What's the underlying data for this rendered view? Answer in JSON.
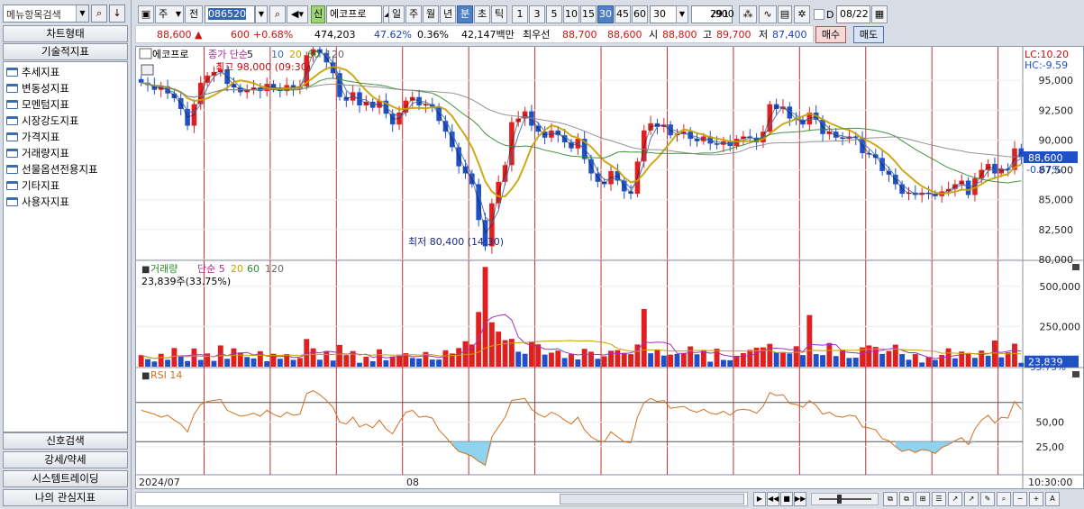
{
  "left_panel": {
    "search_placeholder": "메뉴항목검색",
    "search_btn": "Q",
    "down_btn": "↓",
    "tab_chart_type": "차트형태",
    "tab_tech": "기술적지표",
    "tree": [
      "추세지표",
      "변동성지표",
      "모멘텀지표",
      "시장강도지표",
      "가격지표",
      "거래량지표",
      "선물옵션전용지표",
      "기타지표",
      "사용자지표"
    ],
    "bottom_tabs": [
      "신호검색",
      "강세/약세",
      "시스템트레이딩",
      "나의 관심지표"
    ]
  },
  "toolbar": {
    "period_main": "주",
    "period_prev": "전",
    "code": "086520",
    "new_badge": "신",
    "stock_name": "에코프로",
    "period_buttons": [
      "일",
      "주",
      "월",
      "년",
      "분",
      "초",
      "틱"
    ],
    "active_period": "분",
    "intervals": [
      "1",
      "3",
      "5",
      "10",
      "15",
      "30",
      "45",
      "60"
    ],
    "active_interval": "30",
    "interval_select": "30",
    "count_value": "291",
    "count_total": "/900",
    "date_value": "08/22",
    "check_label": "D"
  },
  "quote": {
    "price": "88,600",
    "arrow": "▲",
    "change": "600",
    "change_pct": "+0.68%",
    "volume": "474,203",
    "ratio1": "47.62%",
    "ratio2": "0.36%",
    "amount": "42,147백만",
    "bid_label": "최우선",
    "bid1": "88,700",
    "bid2": "88,600",
    "open_label": "시",
    "open": "88,800",
    "high_label": "고",
    "high": "89,700",
    "low_label": "저",
    "low": "87,400",
    "buy_label": "매수",
    "sell_label": "매도"
  },
  "chart_data": [
    {
      "type": "candlestick",
      "title": "에코프로",
      "indicator": "종가 단순 5 10 20 60 120",
      "ma_periods": [
        "5",
        "10",
        "20",
        "60",
        "120"
      ],
      "ma_colors": [
        "#1a1a1a",
        "#3a6db5",
        "#c9a000",
        "#2e8b2e",
        "#888888"
      ],
      "ylim": [
        80000,
        97500
      ],
      "yticks": [
        "95,000",
        "92,500",
        "90,000",
        "87,500",
        "85,000",
        "82,500",
        "80,000"
      ],
      "last_price_label": "88,600",
      "last_pct_label": "-0.67%",
      "lc_label": "LC:10.20",
      "hc_label": "HC:-9.59",
      "max_label": "최고 98,000 (09:30)",
      "min_label": "최저 80,400 (14:30)",
      "close": [
        94800,
        94600,
        94200,
        94500,
        93900,
        93500,
        92600,
        91200,
        93000,
        94800,
        95400,
        95700,
        95900,
        94700,
        94400,
        94000,
        94200,
        94400,
        94100,
        94700,
        94300,
        94100,
        94600,
        94300,
        94500,
        97100,
        97600,
        97300,
        96500,
        95600,
        93600,
        93300,
        94000,
        92900,
        93200,
        92700,
        93300,
        92200,
        91300,
        92300,
        93300,
        93600,
        92900,
        93000,
        92800,
        91600,
        90700,
        89400,
        87800,
        87200,
        86300,
        83300,
        81100,
        84700,
        86500,
        87900,
        91500,
        91800,
        92400,
        91200,
        90700,
        90200,
        90800,
        90400,
        89800,
        89300,
        90100,
        88400,
        87200,
        86500,
        86300,
        87400,
        86600,
        85700,
        85500,
        88200,
        90800,
        91400,
        91100,
        91300,
        90400,
        90500,
        90700,
        90100,
        89900,
        90300,
        89700,
        89600,
        89900,
        89500,
        90100,
        90300,
        90200,
        89800,
        90700,
        93000,
        92600,
        92800,
        91800,
        91700,
        91300,
        92300,
        91700,
        90500,
        90700,
        90200,
        90100,
        90300,
        90200,
        88900,
        88800,
        88500,
        87400,
        87100,
        86300,
        85500,
        85600,
        85400,
        85600,
        85500,
        85300,
        85700,
        85900,
        86300,
        86600,
        85400,
        86800,
        87500,
        88000,
        87200,
        87600,
        87500,
        89300,
        88600
      ],
      "x_ticks": [
        "2024/07",
        "08"
      ],
      "time_label": "10:30:00"
    },
    {
      "type": "bar",
      "title": "거래량",
      "indicator": "거래량 단순 5 20 60 120",
      "ma_periods": [
        "5",
        "20",
        "60",
        "120"
      ],
      "yticks": [
        "500,000",
        "250,000"
      ],
      "ylim": [
        0,
        650000
      ],
      "last_label": "23,839",
      "pct_label": "33.75%",
      "info": "23,839주(33.75%)",
      "values": [
        72000,
        47000,
        32000,
        80000,
        43000,
        116000,
        67000,
        35000,
        113000,
        42000,
        82000,
        36000,
        132000,
        49000,
        114000,
        88000,
        60000,
        51000,
        96000,
        34000,
        80000,
        49000,
        78000,
        42000,
        54000,
        172000,
        114000,
        43000,
        96000,
        38000,
        135000,
        72000,
        97000,
        24000,
        62000,
        34000,
        108000,
        40000,
        62000,
        69000,
        84000,
        54000,
        50000,
        91000,
        44000,
        44000,
        102000,
        82000,
        116000,
        158000,
        138000,
        340000,
        620000,
        276000,
        218000,
        165000,
        173000,
        93000,
        80000,
        157000,
        139000,
        75000,
        87000,
        100000,
        54000,
        79000,
        45000,
        111000,
        93000,
        49000,
        65000,
        99000,
        103000,
        86000,
        78000,
        138000,
        359000,
        83000,
        106000,
        69000,
        75000,
        79000,
        84000,
        126000,
        77000,
        99000,
        31000,
        112000,
        42000,
        40000,
        67000,
        84000,
        104000,
        118000,
        120000,
        142000,
        89000,
        91000,
        82000,
        127000,
        72000,
        321000,
        78000,
        72000,
        147000,
        66000,
        105000,
        54000,
        56000,
        120000,
        132000,
        123000,
        79000,
        98000,
        137000,
        78000,
        43000,
        78000,
        26000,
        60000,
        42000,
        73000,
        114000,
        52000,
        94000,
        84000,
        55000,
        100000,
        68000,
        163000,
        58000,
        89000,
        143000,
        23839
      ],
      "up": [
        1,
        0,
        0,
        1,
        0,
        1,
        0,
        0,
        1,
        0,
        1,
        0,
        1,
        0,
        1,
        1,
        0,
        0,
        1,
        0,
        1,
        0,
        1,
        0,
        1,
        1,
        1,
        0,
        1,
        0,
        1,
        1,
        1,
        0,
        1,
        0,
        1,
        0,
        1,
        1,
        1,
        0,
        0,
        1,
        0,
        0,
        1,
        1,
        1,
        1,
        1,
        1,
        1,
        1,
        1,
        1,
        1,
        0,
        0,
        1,
        1,
        0,
        1,
        1,
        0,
        1,
        0,
        1,
        1,
        0,
        1,
        1,
        1,
        1,
        1,
        1,
        1,
        0,
        1,
        0,
        1,
        0,
        1,
        1,
        0,
        1,
        0,
        1,
        0,
        0,
        1,
        1,
        1,
        1,
        1,
        1,
        0,
        1,
        0,
        1,
        0,
        1,
        0,
        0,
        1,
        0,
        1,
        0,
        0,
        1,
        1,
        1,
        0,
        1,
        1,
        0,
        0,
        1,
        0,
        1,
        0,
        1,
        1,
        0,
        1,
        1,
        0,
        1,
        0,
        1,
        0,
        1,
        1,
        0
      ]
    },
    {
      "type": "line",
      "title": "RSI 14",
      "yticks": [
        "50,00",
        "25,00"
      ],
      "ylim": [
        0,
        100
      ],
      "values": [
        62,
        60,
        58,
        55,
        57,
        52,
        48,
        40,
        58,
        68,
        71,
        72,
        73,
        62,
        59,
        56,
        57,
        59,
        56,
        62,
        58,
        55,
        60,
        57,
        58,
        79,
        82,
        78,
        72,
        65,
        50,
        48,
        55,
        45,
        48,
        44,
        52,
        43,
        38,
        50,
        60,
        62,
        55,
        56,
        54,
        42,
        35,
        27,
        20,
        18,
        15,
        10,
        6,
        35,
        45,
        55,
        72,
        73,
        74,
        63,
        58,
        55,
        60,
        57,
        52,
        48,
        55,
        42,
        35,
        31,
        30,
        40,
        35,
        30,
        29,
        55,
        70,
        74,
        71,
        72,
        64,
        65,
        66,
        62,
        60,
        63,
        59,
        58,
        61,
        57,
        62,
        63,
        62,
        59,
        66,
        80,
        77,
        78,
        69,
        68,
        65,
        72,
        67,
        58,
        60,
        56,
        55,
        57,
        56,
        45,
        44,
        42,
        33,
        31,
        25,
        20,
        22,
        19,
        22,
        21,
        18,
        24,
        27,
        31,
        34,
        27,
        43,
        52,
        57,
        49,
        55,
        54,
        71,
        63
      ]
    }
  ]
}
